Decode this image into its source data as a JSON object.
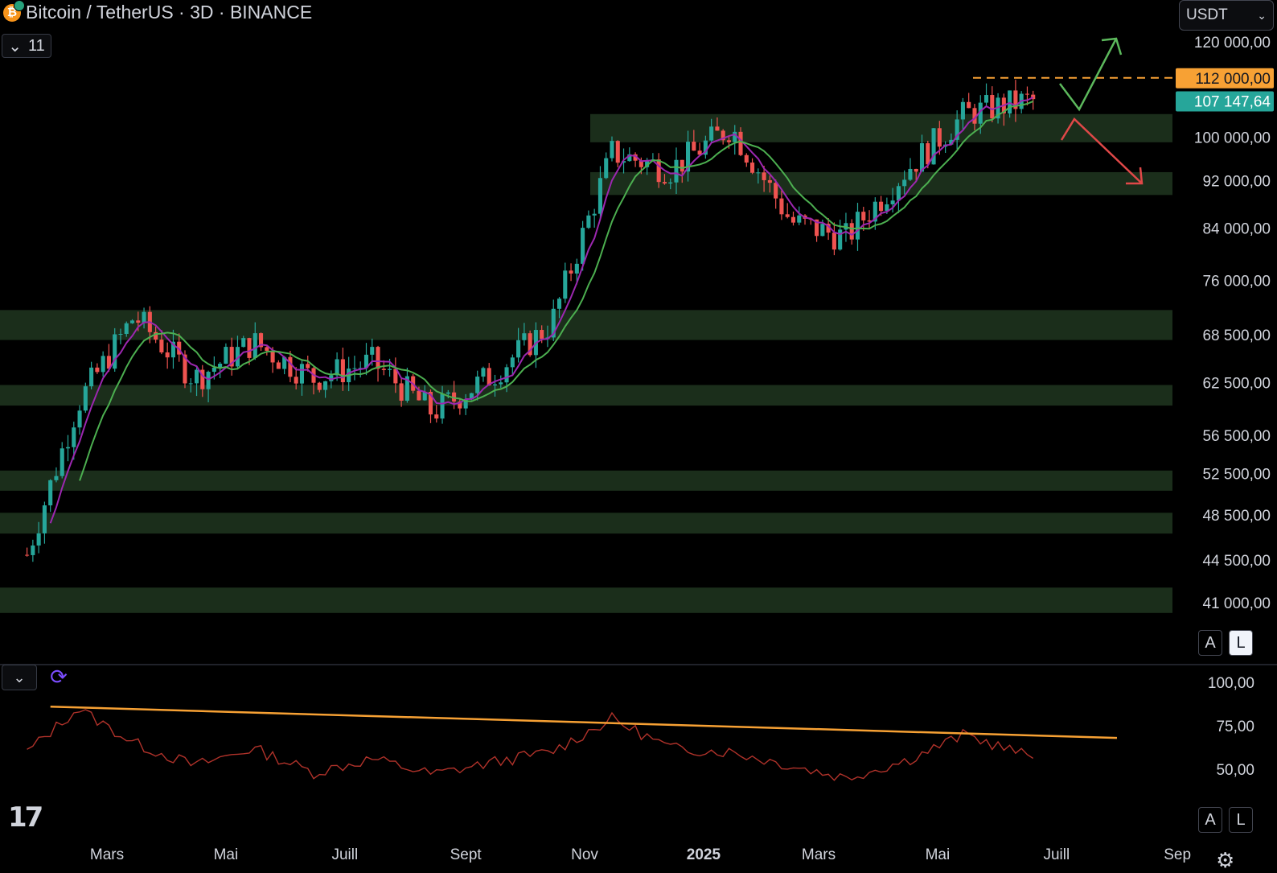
{
  "header": {
    "title": "Bitcoin / TetherUS · 3D · BINANCE",
    "indicator_count": "11"
  },
  "currency_selector": {
    "value": "USDT",
    "icon": "chevron-down-icon"
  },
  "scale_buttons": [
    {
      "label": "A",
      "active": false
    },
    {
      "label": "L",
      "active": true
    }
  ],
  "colors": {
    "up": "#26a69a",
    "down": "#ef5350",
    "ma_fast": "#9c27b0",
    "ma_slow": "#4caf50",
    "zone": "#1b2e1b",
    "target": "#f7a134",
    "last_price": "#26a69a",
    "rsi": "#b0322a",
    "trendline": "#f7a134"
  },
  "chart_data": {
    "type": "candlestick",
    "price_scale": "log",
    "ylim": [
      36000,
      128000
    ],
    "price_axis_ticks": [
      "120 000,00",
      "100 000,00",
      "92 000,00",
      "84 000,00",
      "76 000,00",
      "68 500,00",
      "62 500,00",
      "56 500,00",
      "52 500,00",
      "48 500,00",
      "44 500,00",
      "41 000,00"
    ],
    "price_axis_values": [
      120000,
      100000,
      92000,
      84000,
      76000,
      68500,
      62500,
      56500,
      52500,
      48500,
      44500,
      41000
    ],
    "time_axis_labels": [
      "Mars",
      "Mai",
      "Juill",
      "Sept",
      "Nov",
      "2025",
      "Mars",
      "Mai",
      "Juill",
      "Sep"
    ],
    "time_axis_months": [
      "2024-03",
      "2024-05",
      "2024-07",
      "2024-09",
      "2024-11",
      "2025-01",
      "2025-03",
      "2025-05",
      "2025-07",
      "2025-09"
    ],
    "target_label": {
      "price": 112000,
      "text": "112 000,00"
    },
    "last_price_label": {
      "price": 107147.64,
      "text": "107 147,64"
    },
    "support_resistance_zones": [
      [
        99000,
        104500
      ],
      [
        89500,
        93500
      ],
      [
        67800,
        71800
      ],
      [
        59800,
        62200
      ],
      [
        50800,
        52800
      ],
      [
        46800,
        48700
      ],
      [
        40200,
        42200
      ]
    ],
    "scenario_arrows": [
      {
        "direction": "up",
        "color": "#5cb85c"
      },
      {
        "direction": "down",
        "color": "#e04848"
      }
    ],
    "price_path_monthly": [
      {
        "month": "2024-01",
        "close": 42500
      },
      {
        "month": "2024-02",
        "close": 60000
      },
      {
        "month": "2024-03",
        "close": 71000
      },
      {
        "month": "2024-04",
        "close": 63000
      },
      {
        "month": "2024-05",
        "close": 67500
      },
      {
        "month": "2024-06",
        "close": 63000
      },
      {
        "month": "2024-07",
        "close": 65000
      },
      {
        "month": "2024-08",
        "close": 59000
      },
      {
        "month": "2024-09",
        "close": 63500
      },
      {
        "month": "2024-10",
        "close": 70000
      },
      {
        "month": "2024-11",
        "close": 97000
      },
      {
        "month": "2024-12",
        "close": 94000
      },
      {
        "month": "2025-01",
        "close": 102000
      },
      {
        "month": "2025-02",
        "close": 85000
      },
      {
        "month": "2025-03",
        "close": 82500
      },
      {
        "month": "2025-04",
        "close": 94000
      },
      {
        "month": "2025-05",
        "close": 104500
      },
      {
        "month": "2025-06",
        "close": 107147
      }
    ],
    "rsi": {
      "ylim": [
        30,
        100
      ],
      "axis_ticks": [
        "100,00",
        "75,00",
        "50,00"
      ],
      "axis_values": [
        100,
        75,
        50
      ],
      "trendline": [
        {
          "month": "2024-02",
          "value": 86
        },
        {
          "month": "2025-08",
          "value": 68
        }
      ],
      "values_monthly": [
        {
          "month": "2024-01",
          "value": 55
        },
        {
          "month": "2024-02",
          "value": 85
        },
        {
          "month": "2024-03",
          "value": 65
        },
        {
          "month": "2024-04",
          "value": 52
        },
        {
          "month": "2024-05",
          "value": 62
        },
        {
          "month": "2024-06",
          "value": 48
        },
        {
          "month": "2024-07",
          "value": 56
        },
        {
          "month": "2024-08",
          "value": 47
        },
        {
          "month": "2024-09",
          "value": 54
        },
        {
          "month": "2024-10",
          "value": 60
        },
        {
          "month": "2024-11",
          "value": 79
        },
        {
          "month": "2024-12",
          "value": 62
        },
        {
          "month": "2025-01",
          "value": 60
        },
        {
          "month": "2025-02",
          "value": 52
        },
        {
          "month": "2025-03",
          "value": 45
        },
        {
          "month": "2025-04",
          "value": 55
        },
        {
          "month": "2025-05",
          "value": 70
        },
        {
          "month": "2025-06",
          "value": 58
        }
      ]
    }
  }
}
